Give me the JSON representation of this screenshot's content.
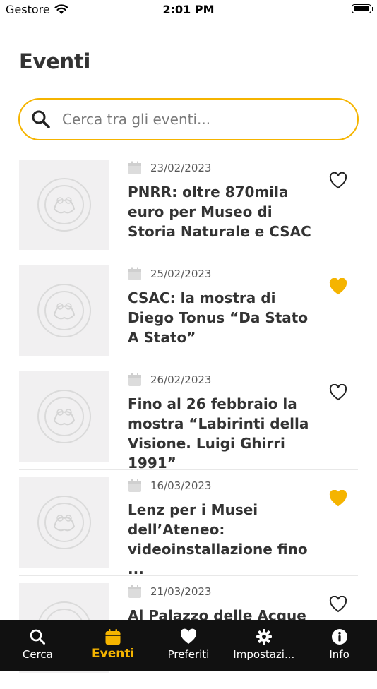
{
  "status_bar": {
    "carrier": "Gestore",
    "time": "2:01 PM"
  },
  "page": {
    "title": "Eventi"
  },
  "search": {
    "placeholder": "Cerca tra gli eventi..."
  },
  "colors": {
    "accent": "#f5b400",
    "tabbar_bg": "#111111",
    "thumb_bg": "#f1f0f1"
  },
  "events": [
    {
      "date": "23/02/2023",
      "title": "PNRR: oltre 870mila euro per Museo di Storia Naturale e CSAC",
      "favorite": false
    },
    {
      "date": "25/02/2023",
      "title": "CSAC: la mostra di Diego Tonus “Da Stato A Stato”",
      "favorite": true
    },
    {
      "date": "26/02/2023",
      "title": "Fino al 26 febbraio la mostra “Labirinti della Visione. Luigi Ghirri 1991”",
      "favorite": false
    },
    {
      "date": "16/03/2023",
      "title": "Lenz per i Musei dell’Ateneo: videoinstallazione fino ...",
      "favorite": true
    },
    {
      "date": "21/03/2023",
      "title": "Al Palazzo delle Acque",
      "favorite": false
    }
  ],
  "tabbar": {
    "tabs": [
      {
        "label": "Cerca",
        "icon": "search-icon"
      },
      {
        "label": "Eventi",
        "icon": "calendar-icon",
        "active": true
      },
      {
        "label": "Preferiti",
        "icon": "heart-icon"
      },
      {
        "label": "Impostazi...",
        "icon": "gear-icon"
      },
      {
        "label": "Info",
        "icon": "info-icon"
      }
    ]
  }
}
